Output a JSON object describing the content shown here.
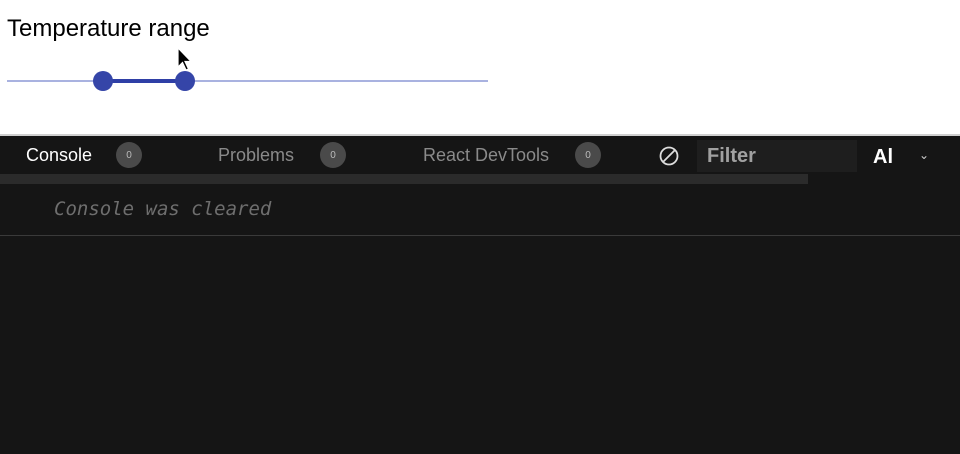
{
  "slider": {
    "label": "Temperature range",
    "min": 0,
    "max": 100,
    "value": [
      20,
      37
    ],
    "color": "#3545a8"
  },
  "console": {
    "tabs": [
      {
        "label": "Console",
        "count": "0",
        "active": true
      },
      {
        "label": "Problems",
        "count": "0",
        "active": false
      },
      {
        "label": "React DevTools",
        "count": "0",
        "active": false
      }
    ],
    "filter_placeholder": "Filter",
    "level": "Al",
    "message": "Console was cleared"
  }
}
